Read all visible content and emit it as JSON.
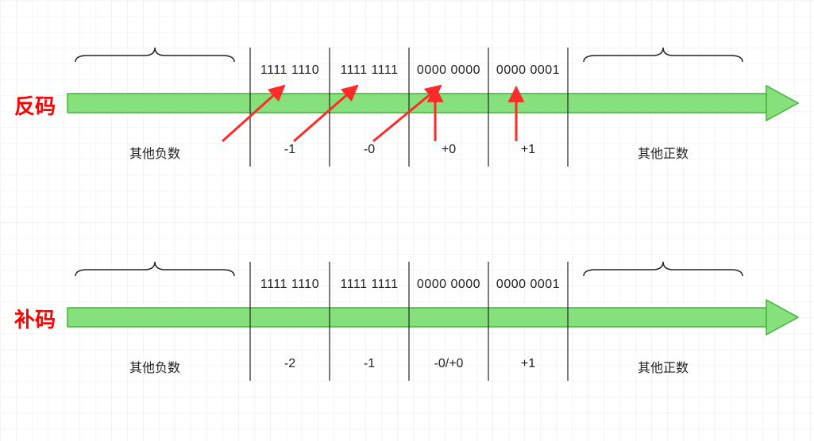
{
  "diagram": {
    "title_top": "反码",
    "title_bottom": "补码",
    "group_neg": "其他负数",
    "group_pos": "其他正数",
    "rows": [
      {
        "id": "ones_complement",
        "cells": [
          {
            "bin": "1111 1110",
            "val": "-1"
          },
          {
            "bin": "1111 1111",
            "val": "-0"
          },
          {
            "bin": "0000 0000",
            "val": "+0"
          },
          {
            "bin": "0000 0001",
            "val": "+1"
          }
        ]
      },
      {
        "id": "twos_complement",
        "cells": [
          {
            "bin": "1111 1110",
            "val": "-2"
          },
          {
            "bin": "1111 1111",
            "val": "-1"
          },
          {
            "bin": "0000 0000",
            "val": "-0/+0"
          },
          {
            "bin": "0000 0001",
            "val": "+1"
          }
        ]
      }
    ]
  }
}
